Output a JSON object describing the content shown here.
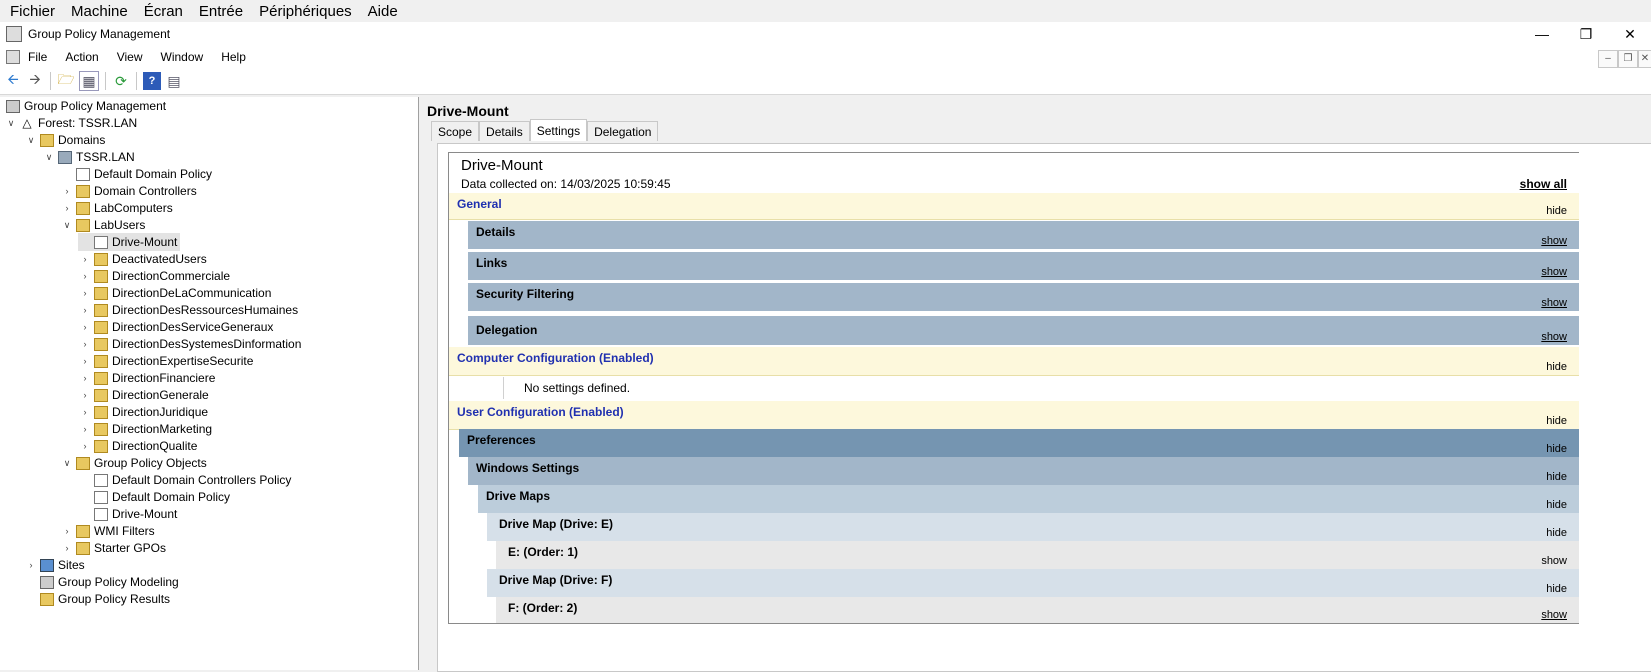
{
  "vm_menu": [
    "Fichier",
    "Machine",
    "Écran",
    "Entrée",
    "Périphériques",
    "Aide"
  ],
  "window": {
    "title": "Group Policy Management"
  },
  "menu": [
    "File",
    "Action",
    "View",
    "Window",
    "Help"
  ],
  "tree": {
    "root": "Group Policy Management",
    "forest": "Forest: TSSR.LAN",
    "domains": "Domains",
    "domain": "TSSR.LAN",
    "default_domain_policy": "Default Domain Policy",
    "domain_controllers": "Domain Controllers",
    "lab_computers": "LabComputers",
    "lab_users": "LabUsers",
    "drive_mount": "Drive-Mount",
    "ous": [
      "DeactivatedUsers",
      "DirectionCommerciale",
      "DirectionDeLaCommunication",
      "DirectionDesRessourcesHumaines",
      "DirectionDesServiceGeneraux",
      "DirectionDesSystemesDinformation",
      "DirectionExpertiseSecurite",
      "DirectionFinanciere",
      "DirectionGenerale",
      "DirectionJuridique",
      "DirectionMarketing",
      "DirectionQualite"
    ],
    "gpo_folder": "Group Policy Objects",
    "gpos": [
      "Default Domain Controllers Policy",
      "Default Domain Policy",
      "Drive-Mount"
    ],
    "wmi_filters": "WMI Filters",
    "starter_gpos": "Starter GPOs",
    "sites": "Sites",
    "modeling": "Group Policy Modeling",
    "results": "Group Policy Results"
  },
  "right": {
    "title": "Drive-Mount",
    "tabs": [
      "Scope",
      "Details",
      "Settings",
      "Delegation"
    ],
    "active_tab": "Settings"
  },
  "report": {
    "title": "Drive-Mount",
    "collected": "Data collected on: 14/03/2025 10:59:45",
    "show_all": "show all",
    "general": "General",
    "details": "Details",
    "links": "Links",
    "security_filtering": "Security Filtering",
    "delegation": "Delegation",
    "computer_config": "Computer Configuration (Enabled)",
    "no_settings": "No settings defined.",
    "user_config": "User Configuration (Enabled)",
    "preferences": "Preferences",
    "windows_settings": "Windows Settings",
    "drive_maps": "Drive Maps",
    "drive_map_e": "Drive Map (Drive: E)",
    "e_order": "E: (Order: 1)",
    "drive_map_f": "Drive Map (Drive: F)",
    "f_order": "F: (Order: 2)",
    "hide": "hide",
    "show": "show"
  }
}
